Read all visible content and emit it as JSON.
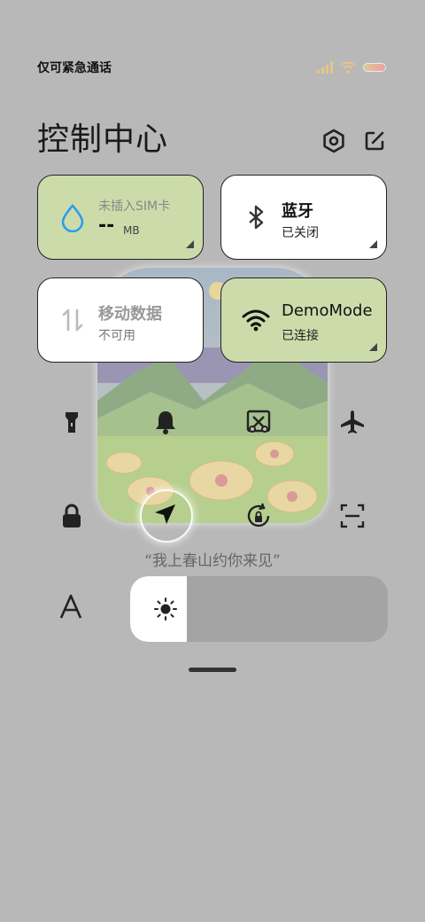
{
  "status_bar": {
    "carrier_text": "仅可紧急通话"
  },
  "header": {
    "title": "控制中心"
  },
  "tiles": {
    "data": {
      "title": "未插入SIM卡",
      "value": "--",
      "unit": "MB"
    },
    "bluetooth": {
      "title": "蓝牙",
      "subtitle": "已关闭"
    },
    "mobile": {
      "title": "移动数据",
      "subtitle": "不可用"
    },
    "wifi": {
      "title": "DemoMode",
      "subtitle": "已连接"
    }
  },
  "quote": "“我上春山约你来见”",
  "brightness": {
    "level": 0.22
  },
  "colors": {
    "tile_active": "#cbdcaa",
    "tile_inactive": "#ffffff",
    "background": "#b8b8b8"
  }
}
